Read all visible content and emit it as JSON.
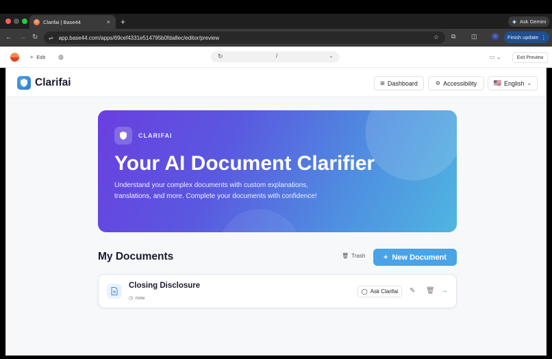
{
  "browser": {
    "tab_title": "Clarifai | Base44",
    "tab_close": "×",
    "new_tab": "+",
    "ask_gemini": "Ask Gemini",
    "url": "app.base44.com/apps/69cef4331e514795b0fda8ec/editor/preview",
    "finish_update": "Finish update",
    "icons": [
      "back-icon",
      "forward-icon",
      "reload-icon",
      "site-info-icon",
      "star-icon",
      "extensions-icon",
      "split-screen-icon",
      "profile-avatar",
      "menu-icon"
    ]
  },
  "editor": {
    "edit_label": "Edit",
    "route_value": "/",
    "exit_preview": "Exit Preview"
  },
  "app": {
    "brand": "Clarifai",
    "nav": {
      "dashboard": "Dashboard",
      "accessibility": "Accessibility",
      "language_flag": "🇺🇸",
      "language": "English"
    },
    "hero": {
      "kicker": "CLARIFAI",
      "title": "Your AI Document Clarifier",
      "description": "Understand your complex documents with custom explanations, translations, and more. Complete your documents with confidence!"
    },
    "documents": {
      "section_title": "My Documents",
      "trash_label": "Trash",
      "new_document_label": "New Document",
      "items": [
        {
          "name": "Closing Disclosure",
          "time": "now",
          "ask_label": "Ask Clarifai"
        }
      ]
    }
  },
  "colors": {
    "accent": "#4aa3e6",
    "hero_start": "#6a3fe0",
    "hero_end": "#4fb6e0",
    "finish_button": "#1f4f8f"
  }
}
